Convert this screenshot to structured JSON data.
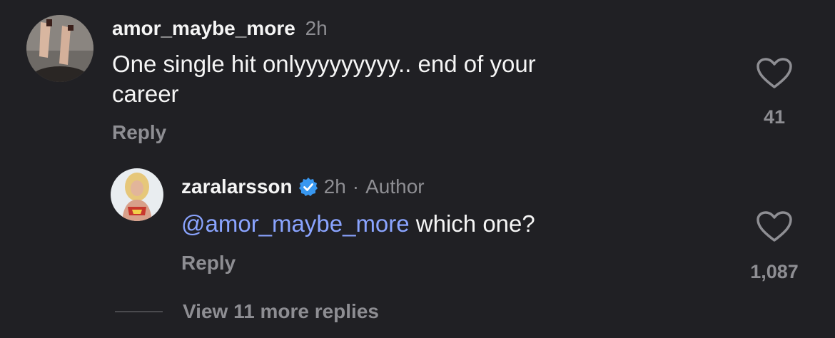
{
  "comment": {
    "username": "amor_maybe_more",
    "time": "2h",
    "text_line1": "One single hit onlyyyyyyyyy.. end of your",
    "text_line2": "career",
    "reply_label": "Reply",
    "like_count": "41",
    "avatar_icon": "user-photo-legs"
  },
  "reply": {
    "username": "zaralarsson",
    "verified_icon": "verified-badge-icon",
    "time": "2h",
    "separator": "·",
    "author_label": "Author",
    "mention": "@amor_maybe_more",
    "text": " which one?",
    "reply_label": "Reply",
    "like_count": "1,087",
    "avatar_icon": "user-photo-blonde"
  },
  "view_more": {
    "label": "View 11 more replies"
  },
  "colors": {
    "background": "#202024",
    "text": "#f5f5f5",
    "muted": "#8e8e93",
    "mention": "#8aa4ff",
    "verified": "#3897f0"
  }
}
